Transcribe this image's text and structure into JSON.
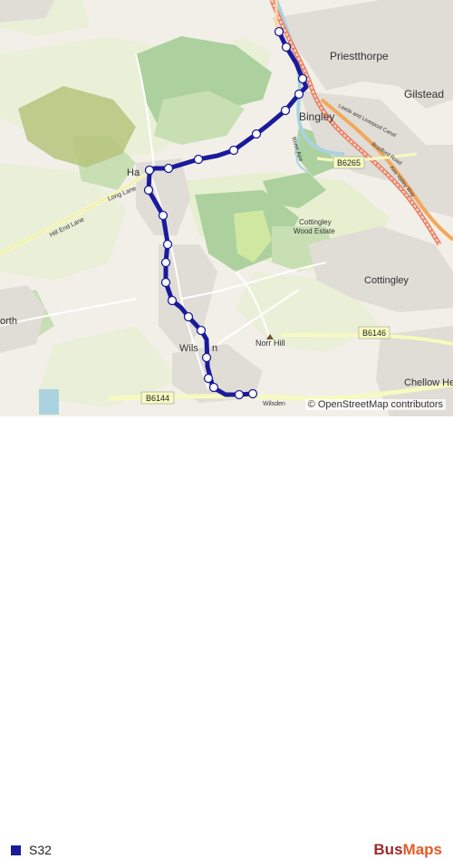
{
  "map": {
    "places": [
      {
        "id": "priestthorpe",
        "name": "Priestthorpe"
      },
      {
        "id": "gilstead",
        "name": "Gilstead"
      },
      {
        "id": "bingley",
        "name": "Bingley"
      },
      {
        "id": "harden",
        "name": "Ha"
      },
      {
        "id": "cottingley-wood",
        "name": "Cottingley\nWood Estate"
      },
      {
        "id": "cottingley",
        "name": "Cottingley"
      },
      {
        "id": "norr-hill",
        "name": "Norr Hill"
      },
      {
        "id": "wilsden",
        "name": "Wils"
      },
      {
        "id": "wilsden-tail",
        "name": "n"
      },
      {
        "id": "north",
        "name": "orth"
      },
      {
        "id": "chellow",
        "name": "Chellow He"
      }
    ],
    "roads": [
      {
        "id": "b6265",
        "name": "B6265"
      },
      {
        "id": "b6146",
        "name": "B6146"
      },
      {
        "id": "b6144",
        "name": "B6144"
      },
      {
        "id": "long-lane",
        "name": "Long Lane"
      },
      {
        "id": "hill-end-lane",
        "name": "Hill End Lane"
      },
      {
        "id": "wilsden-rd",
        "name": "Wilsden"
      },
      {
        "id": "leeds-liverpool",
        "name": "Leeds and Liverpool Canal"
      },
      {
        "id": "river-aire",
        "name": "River Aire"
      },
      {
        "id": "bradford-road",
        "name": "Bradford Road"
      },
      {
        "id": "keighley-way",
        "name": "Aire Valley Way"
      }
    ],
    "route_color": "#1a1a9c",
    "stop_count": 23,
    "attribution": "© OpenStreetMap contributors"
  },
  "legend": {
    "route_name": "S32",
    "route_color": "#1a1a9c"
  },
  "brand": {
    "part1": "Bus",
    "part2": "Maps"
  }
}
